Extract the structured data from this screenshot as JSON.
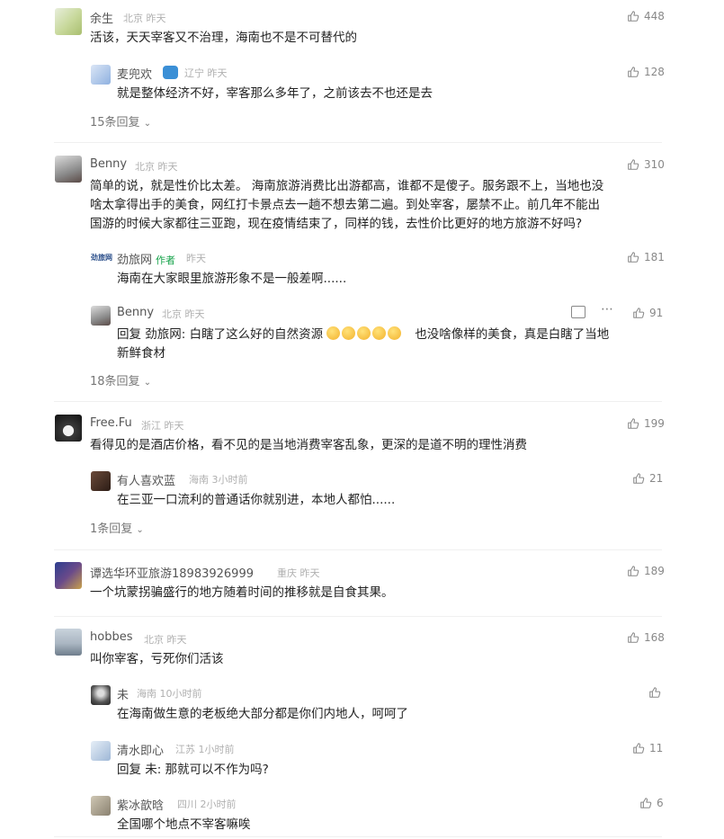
{
  "comments": [
    {
      "name": "余生",
      "location": "北京",
      "time": "昨天",
      "likes": "448",
      "text": "活该，天天宰客又不治理，海南也不是不可替代的",
      "replies": [
        {
          "name": "麦兜欢",
          "badge": true,
          "location": "辽宁",
          "time": "昨天",
          "likes": "128",
          "text": "就是整体经济不好，宰客那么多年了，之前该去不也还是去"
        }
      ],
      "more": "15条回复"
    },
    {
      "name": "Benny",
      "location": "北京",
      "time": "昨天",
      "likes": "310",
      "text_lines": [
        "简单的说，就是性价比太差。 海南旅游消费比出游都高，谁都不是傻子。服务跟不上，当地也没",
        "啥太拿得出手的美食，网红打卡景点去一趟不想去第二遍。到处宰客，屡禁不止。前几年不能出",
        "国游的时候大家都往三亚跑，现在疫情结束了，同样的钱，去性价比更好的地方旅游不好吗?"
      ],
      "replies": [
        {
          "name": "劲旅网",
          "author_tag": "作者",
          "avatar_text": "劲旅网",
          "time": "昨天",
          "likes": "181",
          "text": "海南在大家眼里旅游形象不是一般差啊......"
        },
        {
          "name": "Benny",
          "location": "北京",
          "time": "昨天",
          "likes": "91",
          "text_line1_a": "回复 劲旅网: 白瞎了这么好的自然资源",
          "text_line1_b": "也没啥像样的美食，真是白瞎了当地",
          "text_line2": "新鲜食材"
        }
      ],
      "more": "18条回复"
    },
    {
      "name": "Free.Fu",
      "location": "浙江",
      "time": "昨天",
      "likes": "199",
      "text": "看得见的是酒店价格，看不见的是当地消费宰客乱象，更深的是道不明的理性消费",
      "replies": [
        {
          "name": "有人喜欢蓝",
          "location": "海南",
          "time": "3小时前",
          "likes": "21",
          "text": "在三亚一口流利的普通话你就别进，本地人都怕......"
        }
      ],
      "more": "1条回复"
    },
    {
      "name": "谭选华环亚旅游18983926999",
      "location": "重庆",
      "time": "昨天",
      "likes": "189",
      "text": "一个坑蒙拐骗盛行的地方随着时间的推移就是自食其果。"
    },
    {
      "name": "hobbes",
      "location": "北京",
      "time": "昨天",
      "likes": "168",
      "text": "叫你宰客，亏死你们活该",
      "replies": [
        {
          "name": "未",
          "location": "海南",
          "time": "10小时前",
          "likes": "",
          "text": "在海南做生意的老板绝大部分都是你们内地人，呵呵了"
        },
        {
          "name": "清水即心",
          "location": "江苏",
          "time": "1小时前",
          "likes": "11",
          "text": "回复 未: 那就可以不作为吗?"
        },
        {
          "name": "紫冰歆晗",
          "location": "四川",
          "time": "2小时前",
          "likes": "6",
          "text": "全国哪个地点不宰客嘛唉"
        }
      ]
    }
  ],
  "colors": {
    "author_tag": "#16a34a",
    "meta": "#b0b0b0"
  }
}
